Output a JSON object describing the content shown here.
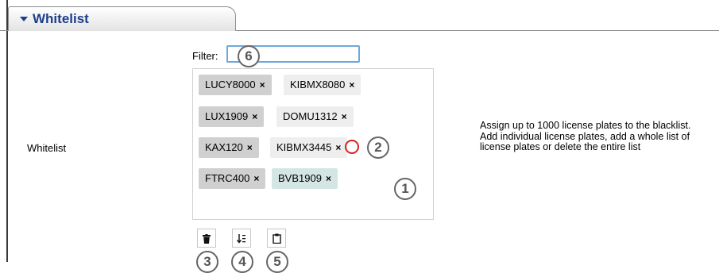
{
  "tab": {
    "label": "Whitelist",
    "caret": "caret-down-icon"
  },
  "row": {
    "label": "Whitelist"
  },
  "filter": {
    "label": "Filter:",
    "value": ""
  },
  "chips": [
    {
      "text": "LUCY8000",
      "remove": "×"
    },
    {
      "text": "KIBMX8080",
      "remove": "×"
    },
    {
      "text": "LUX1909",
      "remove": "×"
    },
    {
      "text": "DOMU1312",
      "remove": "×"
    },
    {
      "text": "KAX120",
      "remove": "×"
    },
    {
      "text": "KIBMX3445",
      "remove": "×"
    },
    {
      "text": "FTRC400",
      "remove": "×"
    },
    {
      "text": "BVB1909",
      "remove": "×"
    }
  ],
  "toolbar": {
    "delete_icon": "trash-icon",
    "sort_icon": "sort-icon",
    "paste_icon": "clipboard-icon"
  },
  "callouts": [
    "1",
    "2",
    "3",
    "4",
    "5",
    "6"
  ],
  "description": "Assign up to 1000 license plates to the blacklist. Add individual license plates, add a whole list of license plates or delete the entire list",
  "colors": {
    "accent": "#1d3f8a",
    "highlight": "#d92020",
    "focus": "#6fa8dc"
  }
}
